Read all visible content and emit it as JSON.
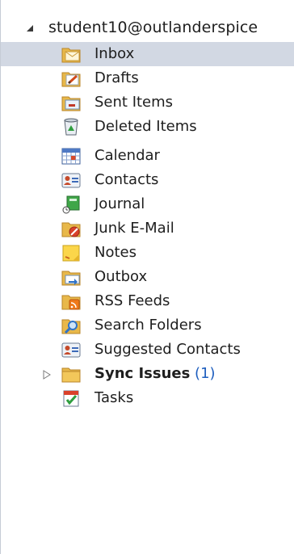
{
  "account": {
    "name": "student10@outlanderspice"
  },
  "folders": [
    {
      "label": "Inbox",
      "icon": "inbox-icon",
      "selected": true
    },
    {
      "label": "Drafts",
      "icon": "drafts-icon"
    },
    {
      "label": "Sent Items",
      "icon": "sent-items-icon"
    },
    {
      "label": "Deleted Items",
      "icon": "deleted-items-icon"
    },
    {
      "label": "Calendar",
      "icon": "calendar-icon"
    },
    {
      "label": "Contacts",
      "icon": "contacts-icon"
    },
    {
      "label": "Journal",
      "icon": "journal-icon"
    },
    {
      "label": "Junk E-Mail",
      "icon": "junk-email-icon"
    },
    {
      "label": "Notes",
      "icon": "notes-icon"
    },
    {
      "label": "Outbox",
      "icon": "outbox-icon"
    },
    {
      "label": "RSS Feeds",
      "icon": "rss-feeds-icon"
    },
    {
      "label": "Search Folders",
      "icon": "search-folders-icon"
    },
    {
      "label": "Suggested Contacts",
      "icon": "suggested-contacts-icon"
    },
    {
      "label": "Sync Issues",
      "count": "(1)",
      "icon": "sync-issues-folder-icon",
      "bold": true,
      "expandable": true
    },
    {
      "label": "Tasks",
      "icon": "tasks-icon"
    }
  ],
  "colors": {
    "selected_bg": "#d2d8e3",
    "count_color": "#1f5fbf"
  }
}
